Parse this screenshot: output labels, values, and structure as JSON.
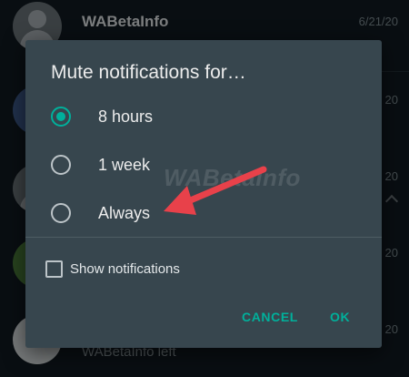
{
  "background": {
    "chats": [
      {
        "name": "WABetaInfo",
        "date": "6/21/20",
        "preview": ""
      },
      {
        "name": "",
        "date": "20",
        "preview": ""
      },
      {
        "name": "",
        "date": "20",
        "preview": ""
      },
      {
        "name": "",
        "date": "20",
        "preview": ""
      },
      {
        "name": "",
        "date": "20",
        "preview": "WABetaInfo left"
      }
    ]
  },
  "dialog": {
    "title": "Mute notifications for…",
    "options": [
      {
        "label": "8 hours",
        "selected": true
      },
      {
        "label": "1 week",
        "selected": false
      },
      {
        "label": "Always",
        "selected": false
      }
    ],
    "checkbox_label": "Show notifications",
    "checkbox_checked": false,
    "cancel_label": "CANCEL",
    "ok_label": "OK"
  },
  "watermark_text": "WABetaInfo",
  "colors": {
    "accent": "#00b09b",
    "dialog_bg": "#37464e",
    "app_bg": "#121b22",
    "annotation_arrow": "#e8414a"
  },
  "icons": [
    "person-avatar-icon",
    "radio-selected-icon",
    "radio-unselected-icon",
    "checkbox-icon",
    "red-arrow-annotation"
  ]
}
